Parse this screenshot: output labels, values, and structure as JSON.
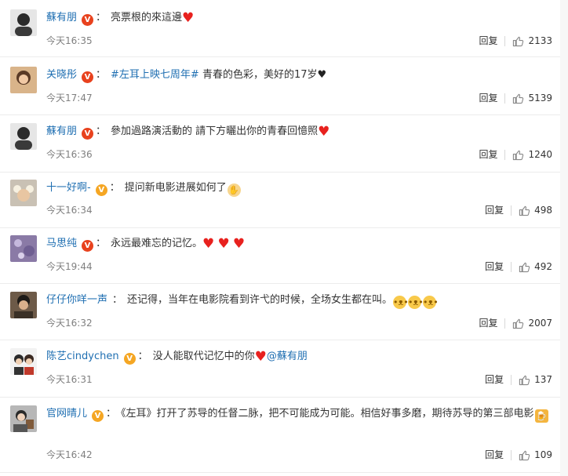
{
  "comments": [
    {
      "user": "蘇有朋",
      "badge": "red",
      "time": "今天16:35",
      "reply": "回复",
      "likes": "2133",
      "text": "亮票根的來這邊"
    },
    {
      "user": "关晓彤",
      "badge": "red",
      "time": "今天17:47",
      "reply": "回复",
      "likes": "5139",
      "topic": "#左耳上映七周年#",
      "text": "青春的色彩，美好的17岁"
    },
    {
      "user": "蘇有朋",
      "badge": "red",
      "time": "今天16:36",
      "reply": "回复",
      "likes": "1240",
      "text": "參加過路演活動的 請下方曬出你的青春回憶照"
    },
    {
      "user": "十一好啊-",
      "badge": "yellow",
      "time": "今天16:34",
      "reply": "回复",
      "likes": "498",
      "text": "提问新电影进展如何了"
    },
    {
      "user": "马思纯",
      "badge": "red",
      "time": "今天19:44",
      "reply": "回复",
      "likes": "492",
      "text": "永远最难忘的记忆。"
    },
    {
      "user": "仔仔你咩一声",
      "badge": "none",
      "time": "今天16:32",
      "reply": "回复",
      "likes": "2007",
      "text": "还记得，当年在电影院看到许弋的时候，全场女生都在叫。"
    },
    {
      "user": "陈艺cindychen",
      "badge": "yellow",
      "time": "今天16:31",
      "reply": "回复",
      "likes": "137",
      "text": "没人能取代记忆中的你",
      "mention": "@蘇有朋"
    },
    {
      "user": "官网晴儿",
      "badge": "yellow",
      "time": "今天16:42",
      "reply": "回复",
      "likes": "109",
      "text": "《左耳》打开了苏导的任督二脉，把不可能成为可能。相信好事多磨，期待苏导的第三部电影"
    }
  ],
  "icons": {
    "heart": "♥",
    "verified": "V",
    "like": "thumbs-up-icon",
    "emoji_hand": "raised-hand",
    "emoji_doge": "doge-face",
    "emoji_cheers": "beer-cheers"
  },
  "colors": {
    "link": "#1f6fb2",
    "heart": "#e8211e",
    "verified_red": "#e8421e",
    "verified_yellow": "#f5a623"
  }
}
